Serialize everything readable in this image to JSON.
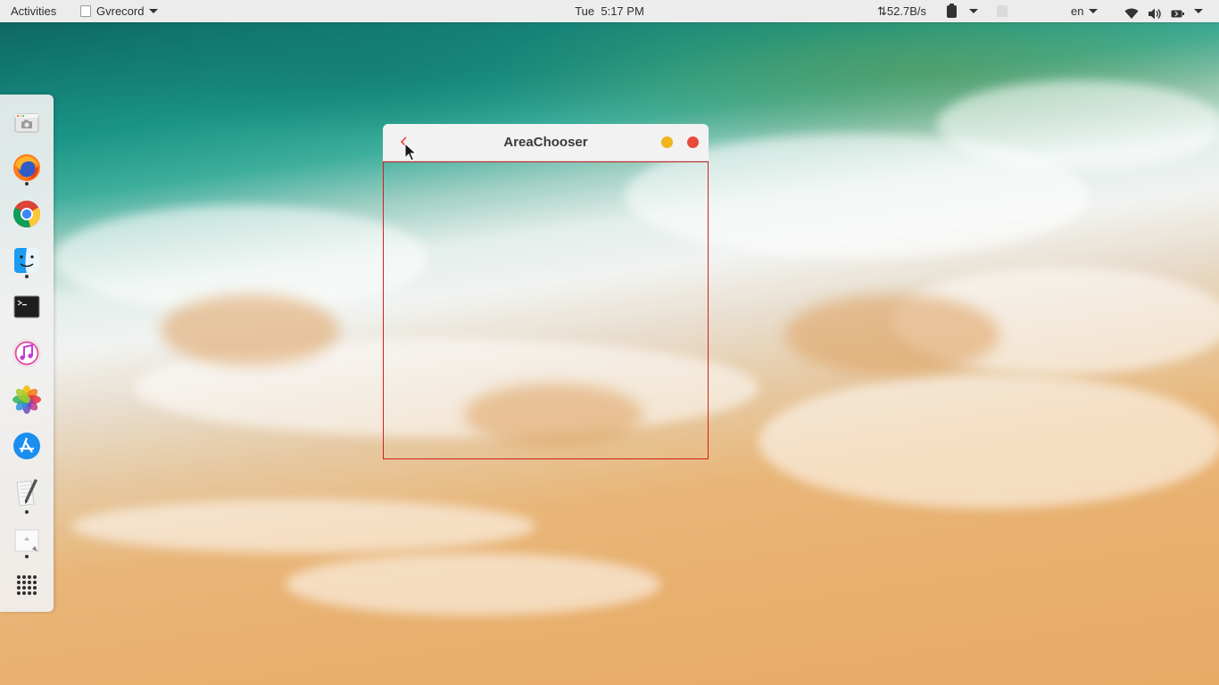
{
  "top_panel": {
    "activities": "Activities",
    "app_name": "Gvrecord",
    "clock": "Tue  5:17 PM",
    "network_speed": "⇅52.7B/s",
    "language": "en",
    "icons": [
      "clipboard-icon",
      "workspace-indicator-icon",
      "wifi-icon",
      "volume-icon",
      "battery-icon"
    ]
  },
  "dock": {
    "items": [
      {
        "name": "screenshot-app-icon",
        "running": false
      },
      {
        "name": "firefox-icon",
        "running": true
      },
      {
        "name": "chrome-icon",
        "running": false
      },
      {
        "name": "finder-icon",
        "running": true
      },
      {
        "name": "terminal-icon",
        "running": false
      },
      {
        "name": "music-icon",
        "running": false
      },
      {
        "name": "photos-icon",
        "running": false
      },
      {
        "name": "app-store-icon",
        "running": false
      },
      {
        "name": "text-editor-icon",
        "running": true
      },
      {
        "name": "gvrecord-icon",
        "running": true
      },
      {
        "name": "show-applications-icon",
        "running": false
      }
    ]
  },
  "window": {
    "title": "AreaChooser",
    "accent_border": "#d02020",
    "minimize_color": "#f1b41c",
    "close_color": "#e84b3c"
  }
}
